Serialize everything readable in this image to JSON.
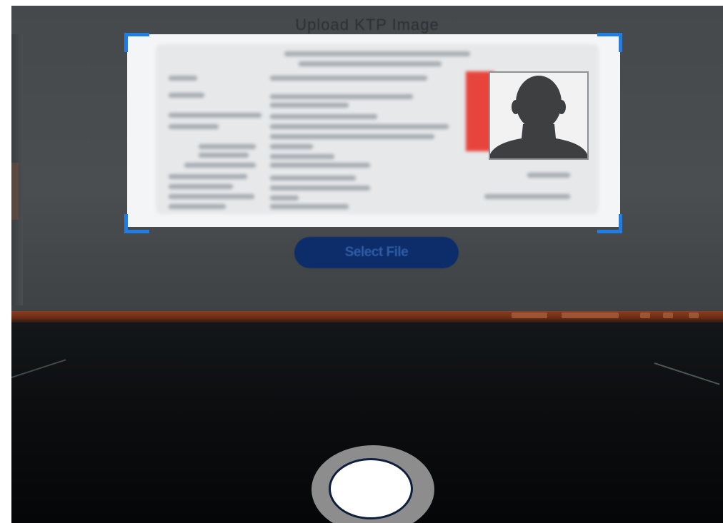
{
  "screen": {
    "title": "Upload KTP Image",
    "select_file_label": "Select File"
  },
  "capture": {
    "frame_color": "#1f7de4",
    "placeholder_icon": "person-silhouette-icon"
  },
  "camera": {
    "shutter_icon": "shutter-button-icon"
  },
  "colors": {
    "select_button": "#0c2d69",
    "shutter_ring": "#8d8d8d"
  }
}
